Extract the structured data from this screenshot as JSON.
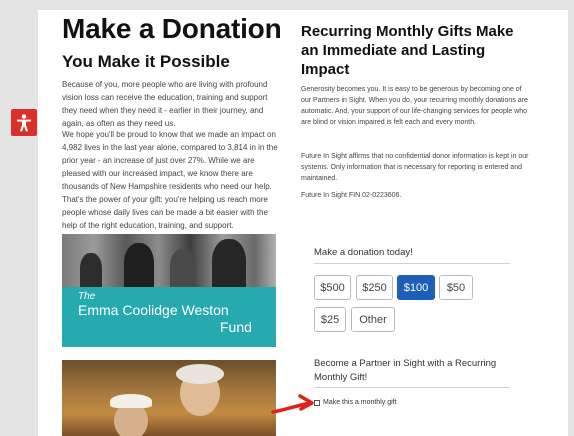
{
  "accessibility": {
    "icon": "accessibility-icon",
    "color": "#d9302c"
  },
  "left": {
    "title": "Make a Donation",
    "subtitle": "You Make it Possible",
    "paragraph1": "Because of you, more people who are living with profound vision loss can receive the education, training and support they need when they need it - earlier in their journey, and again, as often as they need us.",
    "paragraph2": "We hope you'll be proud to know that we made an impact on 4,982 lives in the last year alone, compared to 3,814 in in the prior year - an increase of just over 27%. While we are pleased with our increased impact, we know there are thousands of New Hampshire residents who need our help. That's the power of your gift: you're helping us reach more people whose daily lives can be made a bit easier with the help of the right education, training, and support.",
    "banner": {
      "the": "The",
      "name": "Emma Coolidge Weston",
      "fund": "Fund",
      "color": "#27a9b0"
    }
  },
  "right": {
    "title": "Recurring Monthly Gifts Make an Immediate and Lasting Impact",
    "paragraph1": "Generosity becomes you. It is easy to be generous by becoming one of our Partners in Sight. When you do, your recurring monthly donations are automatic. And, your support of our life-changing services for people who are blind or vision impaired is felt each and every month.",
    "paragraph2": "Future In Sight affirms that no confidential donor information is kept in our systems. Only information that is necessary for reporting is entered and maintained.",
    "fein": "Future In Sight FIN 02-0223606."
  },
  "donation": {
    "heading": "Make a donation today!",
    "amounts": [
      "$500",
      "$250",
      "$100",
      "$50",
      "$25",
      "Other"
    ],
    "selected": "$100",
    "selected_color": "#1d5fb6",
    "partner_heading": "Become a Partner in Sight with a Recurring Monthly Gift!",
    "monthly_label": "Make this a monthly gift",
    "monthly_checked": false
  },
  "annotation": {
    "arrow_color": "#e0201b"
  }
}
